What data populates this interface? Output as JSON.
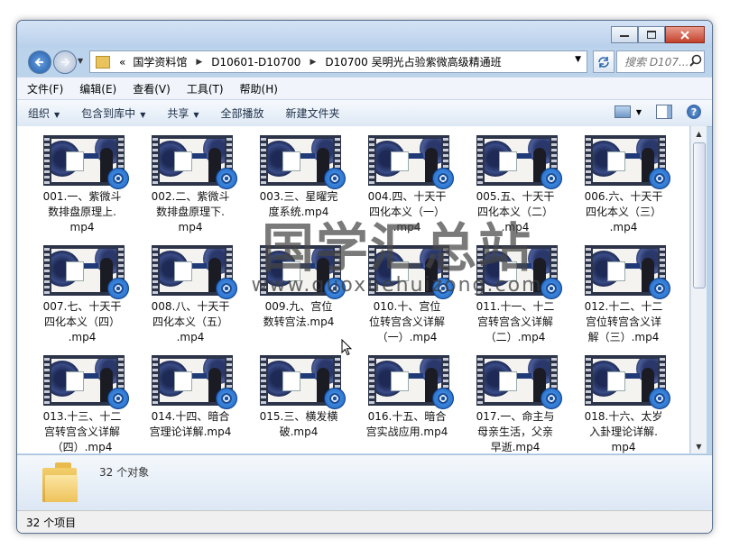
{
  "window": {
    "controls": [
      "minimize",
      "maximize",
      "close"
    ]
  },
  "nav": {
    "breadcrumb_prefix": "«",
    "breadcrumb": [
      "国学资料馆",
      "D10601-D10700",
      "D10700 吴明光占验紫微高级精通班"
    ],
    "search_placeholder": "搜索 D107..."
  },
  "menu": {
    "items": [
      "文件(F)",
      "编辑(E)",
      "查看(V)",
      "工具(T)",
      "帮助(H)"
    ]
  },
  "toolbar": {
    "items": [
      {
        "label": "组织",
        "dropdown": true
      },
      {
        "label": "包含到库中",
        "dropdown": true
      },
      {
        "label": "共享",
        "dropdown": true
      },
      {
        "label": "全部播放",
        "dropdown": false
      },
      {
        "label": "新建文件夹",
        "dropdown": false
      }
    ],
    "help_label": "?"
  },
  "files": [
    {
      "name": "001.一、紫微斗\n数排盘原理上.\nmp4"
    },
    {
      "name": "002.二、紫微斗\n数排盘原理下.\nmp4"
    },
    {
      "name": "003.三、星曜完\n度系统.mp4"
    },
    {
      "name": "004.四、十天干\n四化本义（一）\n.mp4"
    },
    {
      "name": "005.五、十天干\n四化本义（二）\n.mp4"
    },
    {
      "name": "006.六、十天干\n四化本义（三）\n.mp4"
    },
    {
      "name": "007.七、十天干\n四化本义（四）\n.mp4"
    },
    {
      "name": "008.八、十天干\n四化本义（五）\n.mp4"
    },
    {
      "name": "009.九、宫位\n数转宫法.mp4"
    },
    {
      "name": "010.十、宫位\n位转宫含义详解\n（一）.mp4"
    },
    {
      "name": "011.十一、十二\n宫转宫含义详解\n（二）.mp4"
    },
    {
      "name": "012.十二、十二\n宫位转宫含义详\n解（三）.mp4"
    },
    {
      "name": "013.十三、十二\n宫转宫含义详解\n（四）.mp4"
    },
    {
      "name": "014.十四、暗合\n宫理论详解.mp4"
    },
    {
      "name": "015.三、横发横\n破.mp4"
    },
    {
      "name": "016.十五、暗合\n宫实战应用.mp4"
    },
    {
      "name": "017.一、命主与\n母亲生活，父亲\n早逝.mp4"
    },
    {
      "name": "018.十六、太岁\n入卦理论详解.\nmp4"
    }
  ],
  "watermark": {
    "line1": "国学汇总站",
    "line2": "www.guoxuehuizong.com"
  },
  "details": {
    "count": "32 个对象"
  },
  "status": {
    "text": "32 个项目"
  }
}
